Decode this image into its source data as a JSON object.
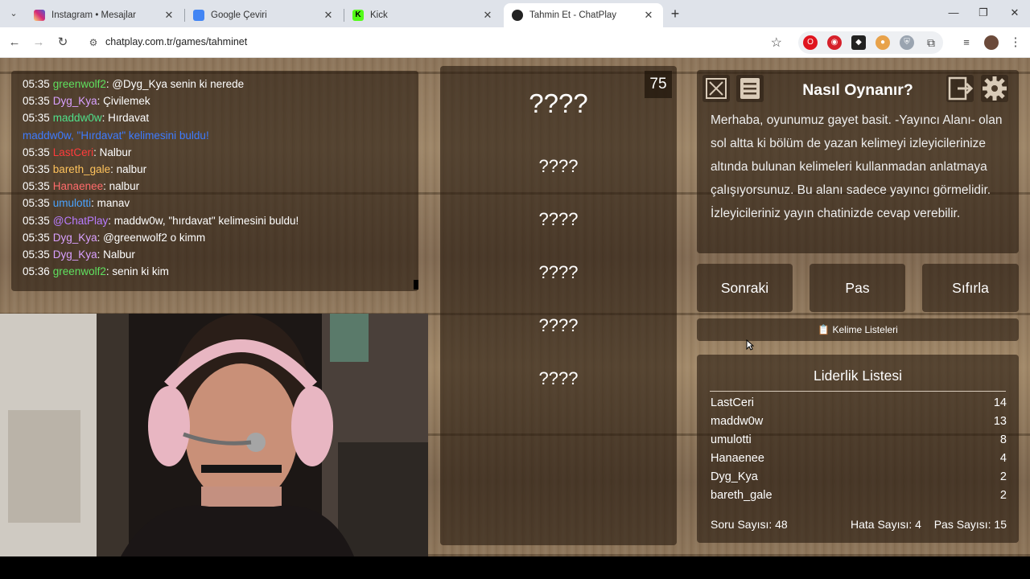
{
  "browser": {
    "tabs": [
      {
        "title": "Instagram • Mesajlar",
        "color": "#d6249f"
      },
      {
        "title": "Google Çeviri",
        "color": "#4285f4"
      },
      {
        "title": "Kick",
        "color": "#53fc18"
      },
      {
        "title": "Tahmin Et - ChatPlay",
        "color": "#222222"
      }
    ],
    "url": "chatplay.com.tr/games/tahminet"
  },
  "chat": {
    "messages": [
      {
        "time": "05:35",
        "user": "greenwolf2",
        "color": "#5fe05f",
        "text": ": @Dyg_Kya senin ki nerede"
      },
      {
        "time": "05:35",
        "user": "Dyg_Kya",
        "color": "#d9a0ff",
        "text": ": Çivilemek"
      },
      {
        "time": "05:35",
        "user": "maddw0w",
        "color": "#4fe08a",
        "text": ": Hırdavat"
      },
      {
        "time": "",
        "user": "maddw0w, \"Hırdavat\" kelimesini buldu!",
        "color": "#3d7bff",
        "text": ""
      },
      {
        "time": "05:35",
        "user": "LastCeri",
        "color": "#ff3b3b",
        "text": ": Nalbur"
      },
      {
        "time": "05:35",
        "user": "bareth_gale",
        "color": "#ffc35c",
        "text": ": nalbur"
      },
      {
        "time": "05:35",
        "user": "Hanaenee",
        "color": "#ff6b6b",
        "text": ": nalbur"
      },
      {
        "time": "05:35",
        "user": "umulotti",
        "color": "#4aa3ff",
        "text": ": manav"
      },
      {
        "time": "05:35",
        "user": "@ChatPlay",
        "color": "#b87cff",
        "text": ": maddw0w, \"hırdavat\" kelimesini buldu!"
      },
      {
        "time": "05:35",
        "user": "Dyg_Kya",
        "color": "#d9a0ff",
        "text": ": @greenwolf2 o kimm"
      },
      {
        "time": "05:35",
        "user": "Dyg_Kya",
        "color": "#d9a0ff",
        "text": ": Nalbur"
      },
      {
        "time": "05:36",
        "user": "greenwolf2",
        "color": "#5fe05f",
        "text": ": senin ki kim"
      }
    ]
  },
  "game": {
    "timer": "75",
    "words": [
      "????",
      "????",
      "????",
      "????",
      "????",
      "????"
    ]
  },
  "howto": {
    "title": "Nasıl Oynanır?",
    "text": "Merhaba, oyunumuz gayet basit. -Yayıncı Alanı- olan sol altta ki bölüm de yazan kelimeyi izleyicilerinize altında bulunan kelimeleri kullanmadan anlatmaya çalışıyorsunuz. Bu alanı sadece yayıncı görmelidir. İzleyicileriniz yayın chatinizde cevap verebilir."
  },
  "actions": {
    "next": "Sonraki",
    "pass": "Pas",
    "reset": "Sıfırla",
    "word_lists": "Kelime Listeleri"
  },
  "leaderboard": {
    "title": "Liderlik Listesi",
    "rows": [
      {
        "name": "LastCeri",
        "score": "14"
      },
      {
        "name": "maddw0w",
        "score": "13"
      },
      {
        "name": "umulotti",
        "score": "8"
      },
      {
        "name": "Hanaenee",
        "score": "4"
      },
      {
        "name": "Dyg_Kya",
        "score": "2"
      },
      {
        "name": "bareth_gale",
        "score": "2"
      }
    ],
    "questions": "Soru Sayısı: 48",
    "errors": "Hata Sayısı: 4",
    "passes": "Pas Sayısı: 15"
  }
}
